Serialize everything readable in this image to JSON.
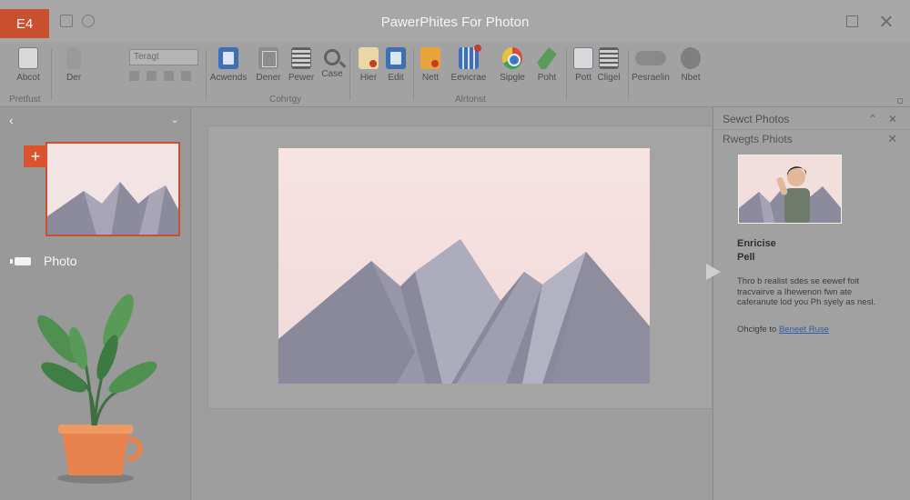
{
  "titlebar": {
    "app_badge": "E4",
    "title": "PawerPhites For Photon"
  },
  "ribbon": {
    "buttons": [
      {
        "label": "Abcot",
        "icon": "document-icon"
      },
      {
        "label": "Der",
        "icon": "pen-icon"
      },
      {
        "label": "Acwends",
        "icon": "file-blue-icon"
      },
      {
        "label": "Dener",
        "icon": "layout-icon"
      },
      {
        "label": "Pewer",
        "icon": "page-icon"
      },
      {
        "label": "Case",
        "icon": "search-icon"
      },
      {
        "label": "Hier",
        "icon": "note-icon"
      },
      {
        "label": "Edit",
        "icon": "edit-icon"
      },
      {
        "label": "Nett",
        "icon": "media-icon"
      },
      {
        "label": "Eevicrae",
        "icon": "grid-icon"
      },
      {
        "label": "Sipgle",
        "icon": "chrome-icon"
      },
      {
        "label": "Poht",
        "icon": "brush-icon"
      },
      {
        "label": "Pott",
        "icon": "page-icon"
      },
      {
        "label": "Cligel",
        "icon": "list-icon"
      },
      {
        "label": "Pesraelin",
        "icon": "cloud-icon"
      },
      {
        "label": "Nbet",
        "icon": "circle-icon"
      }
    ],
    "font_box": "Teragt",
    "groups": {
      "left": "Pretfust",
      "middle": "Cohrtgy",
      "right": "Alrtonst"
    }
  },
  "leftpane": {
    "item_label": "Photo"
  },
  "rightpane": {
    "title": "Sewct Photos",
    "subtitle": "Rwegts Phiots",
    "photo_name_line1": "Enricise",
    "photo_name_line2": "Pell",
    "description": "Thro b realist sdes se eewef foit tracvairve a Ihewenon fwn ate caferanute lod you Ph syely as nesl.",
    "credit_prefix": "Ohcigfe to",
    "credit_link": "Beneet Ruse"
  }
}
